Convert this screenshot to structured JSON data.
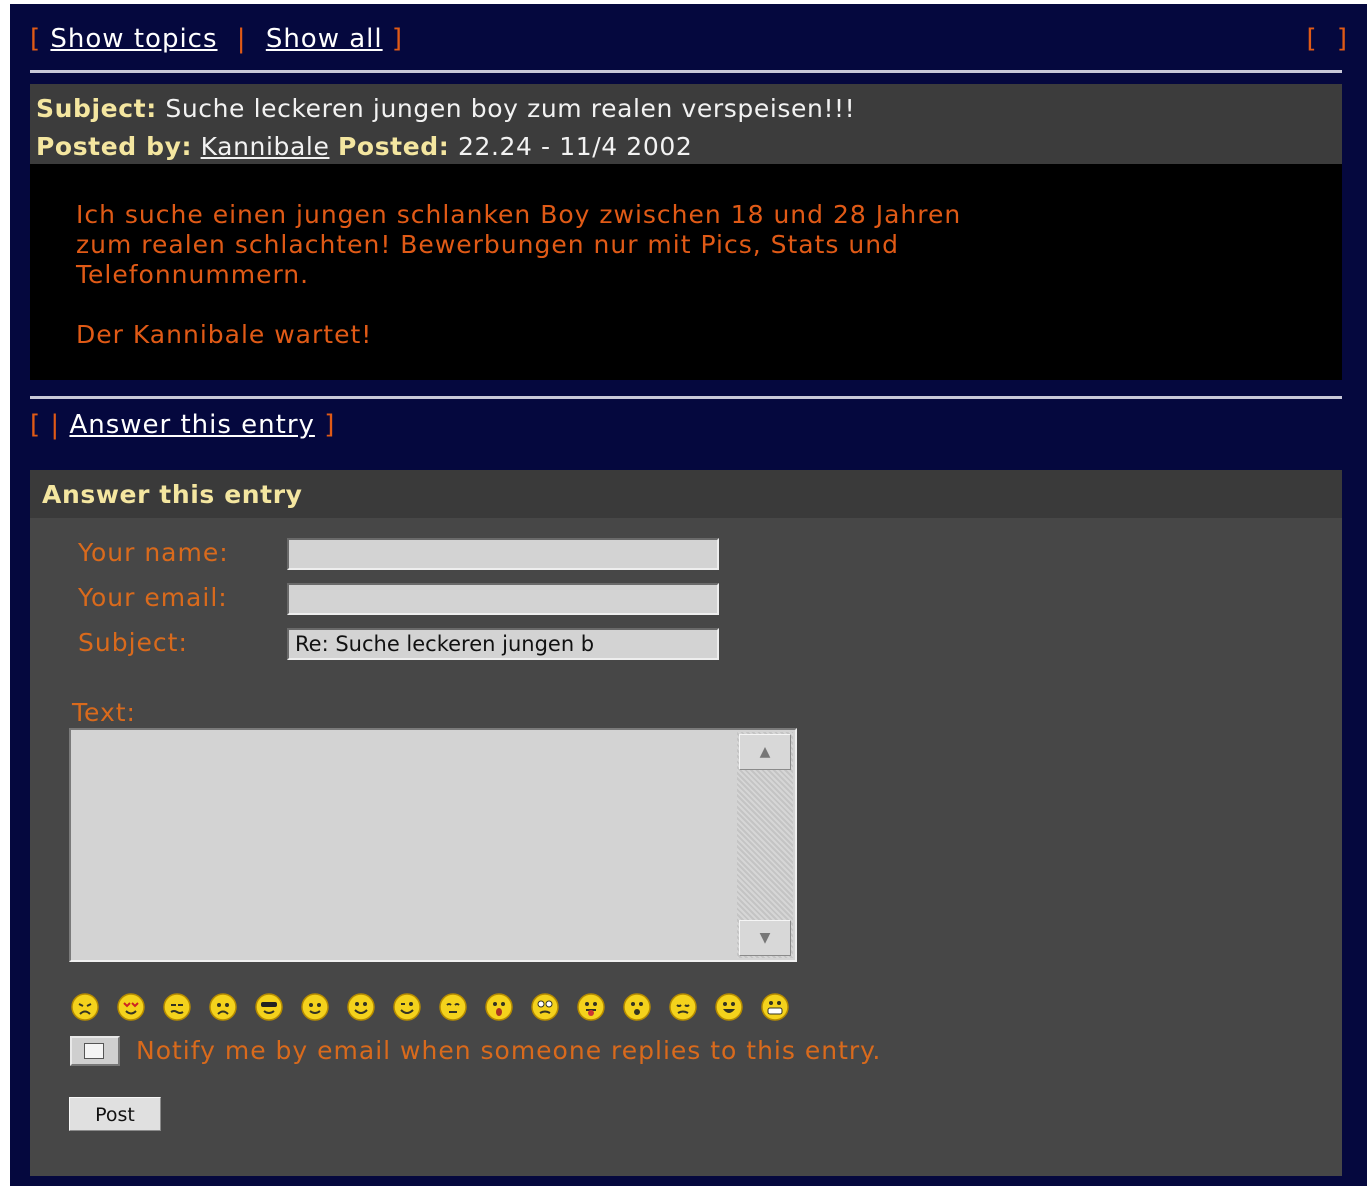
{
  "nav_top": {
    "open_bracket": "[",
    "show_topics": "Show topics",
    "separator": "|",
    "show_all": "Show all",
    "close_bracket": "]",
    "right_brackets": "[ ]"
  },
  "post": {
    "subject_label": "Subject:",
    "subject": "Suche leckeren jungen boy zum realen verspeisen!!!",
    "posted_by_label": "Posted by:",
    "author": "Kannibale",
    "posted_label": "Posted:",
    "posted_date": "22.24 - 11/4 2002",
    "body": "Ich suche einen jungen schlanken Boy zwischen 18 und 28 Jahren\nzum realen schlachten! Bewerbungen nur mit Pics, Stats und\nTelefonnummern.\n\nDer Kannibale wartet!"
  },
  "nav_mid": {
    "prefix": "[  |",
    "answer_link": "Answer this entry",
    "close_bracket": "]"
  },
  "form": {
    "title": "Answer this entry",
    "name_label": "Your name:",
    "name_value": "",
    "email_label": "Your email:",
    "email_value": "",
    "subject_label": "Subject:",
    "subject_value": "Re: Suche leckeren jungen b",
    "text_label": "Text:",
    "text_value": "",
    "smileys": [
      "angry-icon",
      "love-icon",
      "sick-icon",
      "sad-icon",
      "cool-icon",
      "idea-icon",
      "smile-icon",
      "wink-icon",
      "sleepy-icon",
      "shocked-icon",
      "confused-icon",
      "tongue-icon",
      "surprised-icon",
      "crying-icon",
      "happy-icon",
      "grin-icon"
    ],
    "notify_label": "Notify me by email when someone replies to this entry.",
    "notify_checked": false,
    "post_button": "Post"
  },
  "colors": {
    "page_bg": "#05083e",
    "accent_orange": "#e05a16",
    "label_yellow": "#f4e6a0",
    "panel_gray": "#474747"
  }
}
